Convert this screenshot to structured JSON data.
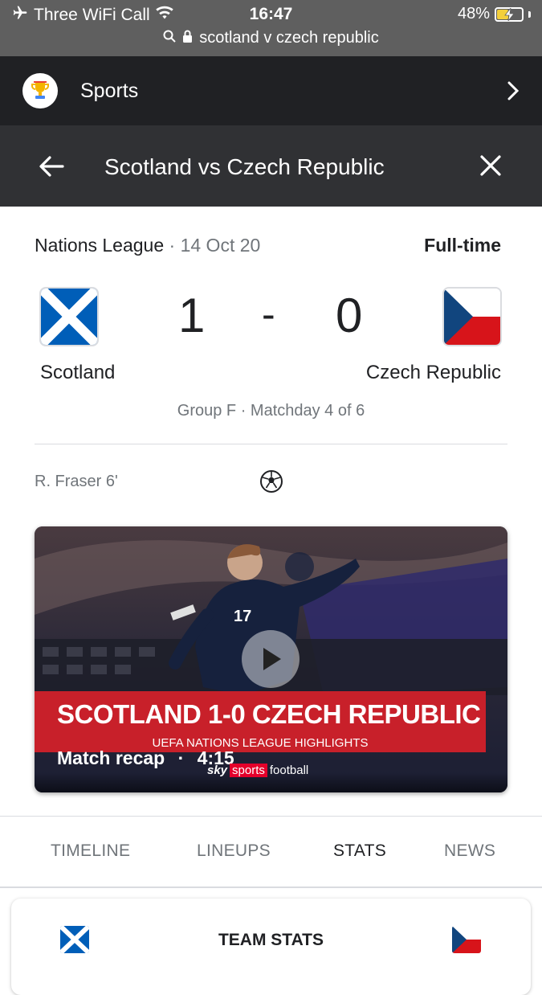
{
  "status_bar": {
    "carrier": "Three WiFi Call",
    "time": "16:47",
    "battery": "48%",
    "battery_level": 0.48,
    "url": "scotland v czech republic"
  },
  "sports_header": {
    "label": "Sports"
  },
  "search": {
    "title": "Scotland vs Czech Republic"
  },
  "match": {
    "competition": "Nations League",
    "separator": "·",
    "date": "14 Oct 20",
    "status": "Full-time",
    "home": {
      "name": "Scotland",
      "score": "1"
    },
    "away": {
      "name": "Czech Republic",
      "score": "0"
    },
    "score_separator": "-",
    "group_info": "Group F · Matchday 4 of 6",
    "scorer": "R. Fraser 6'"
  },
  "video": {
    "banner_title": "SCOTLAND 1-0 CZECH REPUBLIC",
    "banner_subtitle": "UEFA NATIONS LEAGUE HIGHLIGHTS",
    "recap_label": "Match recap",
    "duration_separator": "·",
    "duration": "4:15",
    "logo_sky": "sky",
    "logo_sports": "sports",
    "logo_football": "football"
  },
  "tabs": [
    {
      "label": "TIMELINE",
      "active": false
    },
    {
      "label": "LINEUPS",
      "active": false
    },
    {
      "label": "STATS",
      "active": true
    },
    {
      "label": "NEWS",
      "active": false
    }
  ],
  "team_stats": {
    "title": "TEAM STATS"
  },
  "colors": {
    "status_bar_bg": "#5f5f5f",
    "header_bg": "#202124",
    "search_bg": "#303134",
    "scotland_blue": "#005EB8",
    "czech_red": "#D7141A",
    "czech_blue": "#11457E",
    "banner_red": "#c8202a"
  }
}
